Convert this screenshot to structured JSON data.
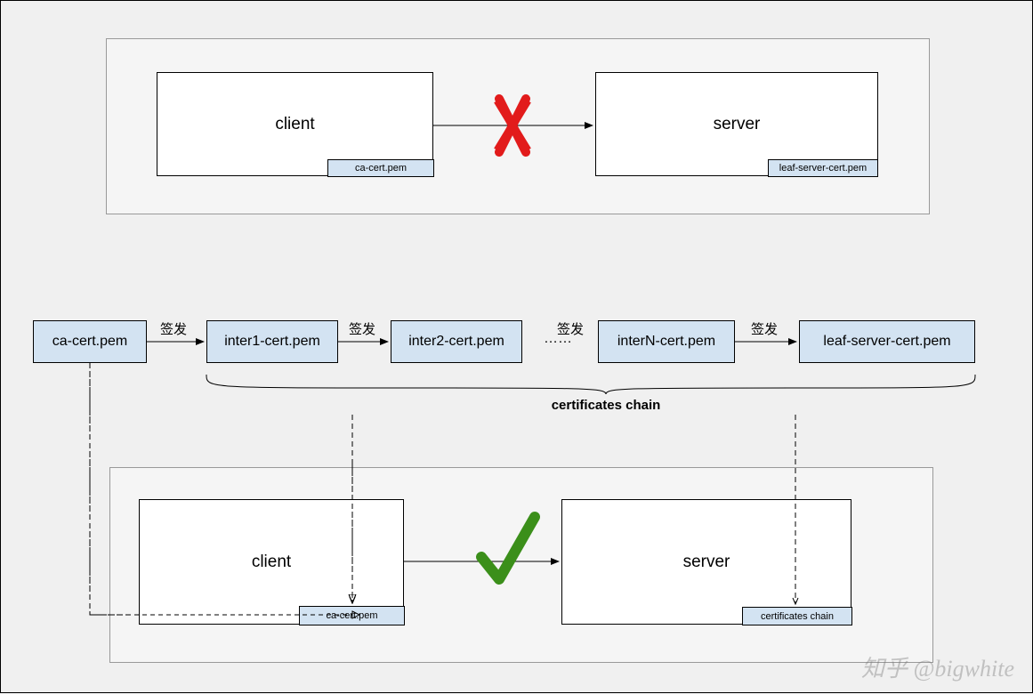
{
  "topPanel": {
    "client": {
      "label": "client",
      "cert": "ca-cert.pem"
    },
    "server": {
      "label": "server",
      "cert": "leaf-server-cert.pem"
    }
  },
  "chain": {
    "box1": "ca-cert.pem",
    "box2": "inter1-cert.pem",
    "box3": "inter2-cert.pem",
    "dots": "……",
    "box4": "interN-cert.pem",
    "box5": "leaf-server-cert.pem",
    "arrowLabel1": "签发",
    "arrowLabel2": "签发",
    "arrowLabel3": "签发",
    "arrowLabel4": "签发",
    "braceLabel": "certificates chain"
  },
  "bottomPanel": {
    "client": {
      "label": "client",
      "cert": "ca-cert.pem"
    },
    "server": {
      "label": "server",
      "cert": "certificates chain"
    }
  },
  "watermark": "知乎 @bigwhite"
}
